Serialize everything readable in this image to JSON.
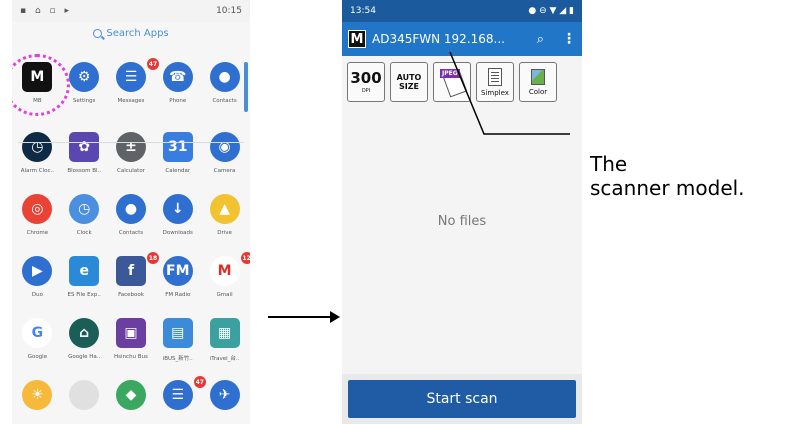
{
  "left_phone": {
    "status_right": "10:15",
    "search_placeholder": "Search Apps",
    "rows": [
      [
        {
          "label": "MB",
          "color": "#111111",
          "glyph": "M",
          "shape": "square"
        },
        {
          "label": "Settings",
          "color": "#2f6fd0",
          "glyph": "⚙"
        },
        {
          "label": "Messages",
          "color": "#2f6fd0",
          "glyph": "☰",
          "badge": "47"
        },
        {
          "label": "Phone",
          "color": "#2f6fd0",
          "glyph": "☎"
        },
        {
          "label": "Contacts",
          "color": "#2f6fd0",
          "glyph": "●"
        }
      ],
      [
        {
          "label": "Alarm Cloc..",
          "color": "#0f2a44",
          "glyph": "◷"
        },
        {
          "label": "Blossom Bl..",
          "color": "#5a48b0",
          "glyph": "✿",
          "shape": "square"
        },
        {
          "label": "Calculator",
          "color": "#5f6368",
          "glyph": "±"
        },
        {
          "label": "Calendar",
          "color": "#3a7de0",
          "glyph": "31",
          "shape": "square"
        },
        {
          "label": "Camera",
          "color": "#2f6fd0",
          "glyph": "◉"
        }
      ],
      [
        {
          "label": "Chrome",
          "color": "#e84335",
          "glyph": "◎"
        },
        {
          "label": "Clock",
          "color": "#4a8fe0",
          "glyph": "◷"
        },
        {
          "label": "Contacts",
          "color": "#2f6fd0",
          "glyph": "●"
        },
        {
          "label": "Downloads",
          "color": "#2f6fd0",
          "glyph": "↓"
        },
        {
          "label": "Drive",
          "color": "#f2c230",
          "glyph": "▲"
        }
      ],
      [
        {
          "label": "Duo",
          "color": "#2f6fd0",
          "glyph": "▶"
        },
        {
          "label": "ES File Exp..",
          "color": "#2a8ad8",
          "glyph": "e",
          "shape": "square"
        },
        {
          "label": "Facebook",
          "color": "#3b5998",
          "glyph": "f",
          "shape": "square",
          "badge": "18"
        },
        {
          "label": "FM Radio",
          "color": "#2f6fd0",
          "glyph": "FM"
        },
        {
          "label": "Gmail",
          "color": "#ffffff",
          "glyph": "M",
          "fg": "#d93025",
          "badge": "12"
        }
      ],
      [
        {
          "label": "Google",
          "color": "#ffffff",
          "glyph": "G",
          "fg": "#4285f4"
        },
        {
          "label": "Google Ha..",
          "color": "#1b5e58",
          "glyph": "⌂"
        },
        {
          "label": "Hsinchu Bus",
          "color": "#6a3fa0",
          "glyph": "▣",
          "shape": "square"
        },
        {
          "label": "iBUS_新竹..",
          "color": "#3c8ad8",
          "glyph": "▤",
          "shape": "square"
        },
        {
          "label": "iTravel_台..",
          "color": "#3ca0a0",
          "glyph": "▦",
          "shape": "square"
        }
      ],
      [
        {
          "label": "",
          "color": "#f6b93b",
          "glyph": "☀"
        },
        {
          "label": "",
          "color": "#e0e0e0",
          "glyph": ""
        },
        {
          "label": "",
          "color": "#3aa860",
          "glyph": "◆"
        },
        {
          "label": "",
          "color": "#2f6fd0",
          "glyph": "☰",
          "badge": "47"
        },
        {
          "label": "",
          "color": "#2f6fd0",
          "glyph": "✈"
        }
      ]
    ]
  },
  "right_phone": {
    "status_time": "13:54",
    "app_title": "AD345FWN  192.168...",
    "logo": "M",
    "toolbar": {
      "dpi_value": "300",
      "dpi_unit": "DPI",
      "size_line1": "AUTO",
      "size_line2": "SIZE",
      "format_tag": "JPEG",
      "simplex": "Simplex",
      "color": "Color"
    },
    "empty_text": "No files",
    "start_button": "Start scan"
  },
  "callout": {
    "line1": "The",
    "line2": "scanner model."
  }
}
